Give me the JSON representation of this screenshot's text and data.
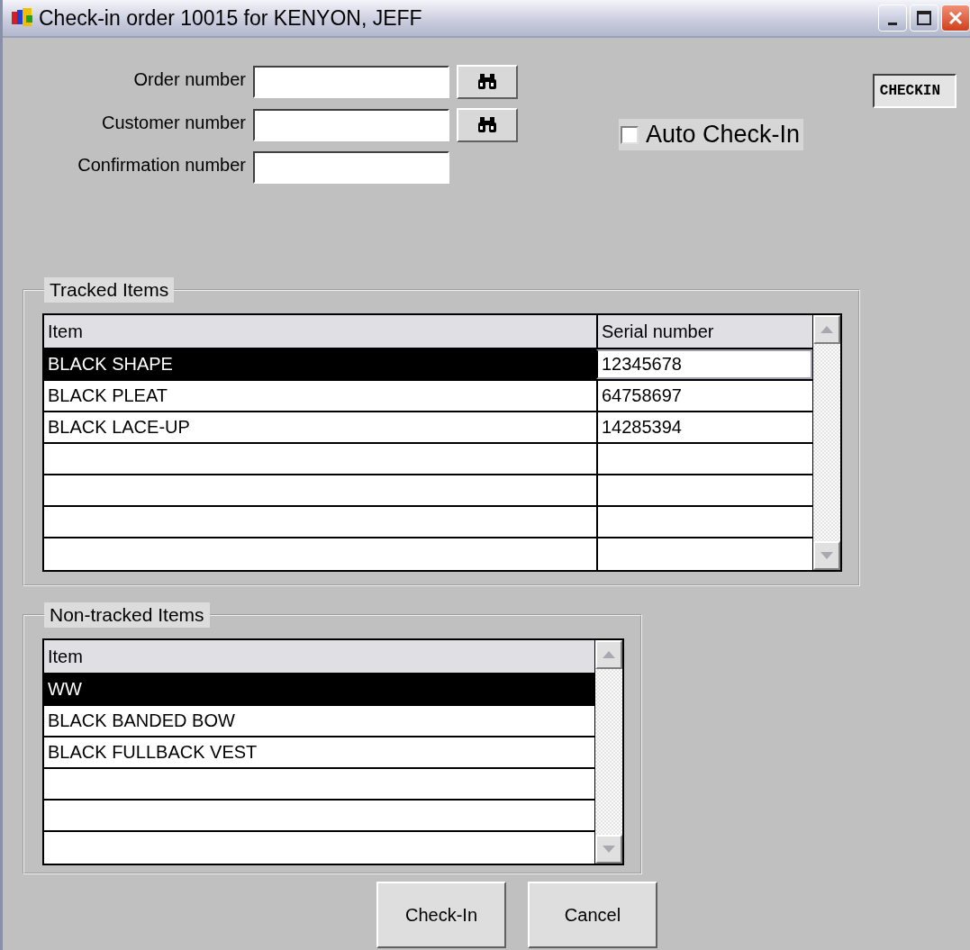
{
  "window": {
    "title": "Check-in order 10015 for KENYON, JEFF"
  },
  "fields": [
    {
      "label": "Order number",
      "lookup": true
    },
    {
      "label": "Customer number",
      "lookup": true
    },
    {
      "label": "Confirmation number",
      "lookup": false
    }
  ],
  "mode_tag": "CHECKIN",
  "auto_checkin": {
    "label": "Auto Check-In",
    "checked": false
  },
  "tracked_items": {
    "title": "Tracked Items",
    "columns": [
      "Item",
      "Serial number"
    ],
    "rows": [
      {
        "item": "BLACK SHAPE",
        "serial": "12345678",
        "selected": true
      },
      {
        "item": "BLACK PLEAT",
        "serial": "64758697",
        "selected": false
      },
      {
        "item": "BLACK LACE-UP",
        "serial": "14285394",
        "selected": false
      }
    ]
  },
  "nontracked_items": {
    "title": "Non-tracked Items",
    "columns": [
      "Item"
    ],
    "rows": [
      {
        "item": "WW",
        "selected": true
      },
      {
        "item": "BLACK BANDED BOW",
        "selected": false
      },
      {
        "item": "BLACK FULLBACK VEST",
        "selected": false
      }
    ]
  },
  "buttons": [
    "Check-In",
    "Cancel"
  ]
}
